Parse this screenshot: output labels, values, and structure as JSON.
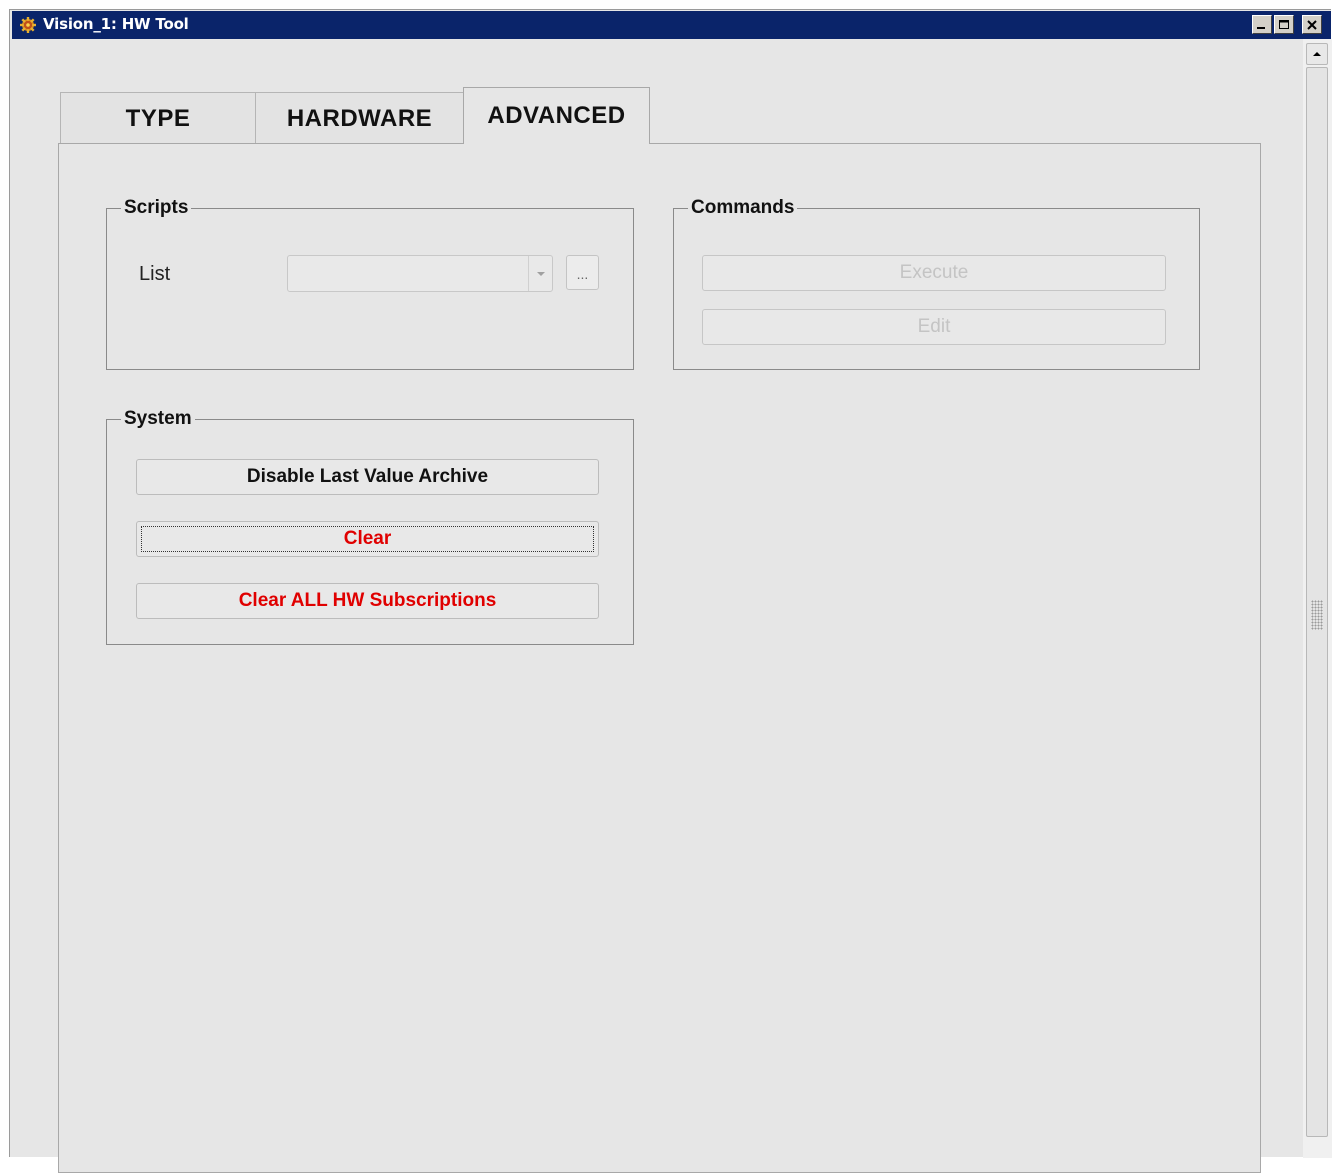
{
  "window": {
    "title": "Vision_1: HW Tool",
    "controls": [
      "minimize",
      "maximize",
      "close"
    ]
  },
  "tabs": [
    {
      "label": "TYPE",
      "active": false
    },
    {
      "label": "HARDWARE",
      "active": false
    },
    {
      "label": "ADVANCED",
      "active": true
    }
  ],
  "scripts": {
    "title": "Scripts",
    "list_label": "List",
    "list_value": "",
    "browse_label": "..."
  },
  "commands": {
    "title": "Commands",
    "execute_label": "Execute",
    "edit_label": "Edit",
    "enabled": false
  },
  "system": {
    "title": "System",
    "disable_archive_label": "Disable Last Value Archive",
    "clear_label": "Clear",
    "clear_all_label": "Clear ALL HW Subscriptions"
  },
  "colors": {
    "titlebar": "#0a246a",
    "danger_text": "#e00000",
    "panel_bg": "#e6e6e6"
  }
}
